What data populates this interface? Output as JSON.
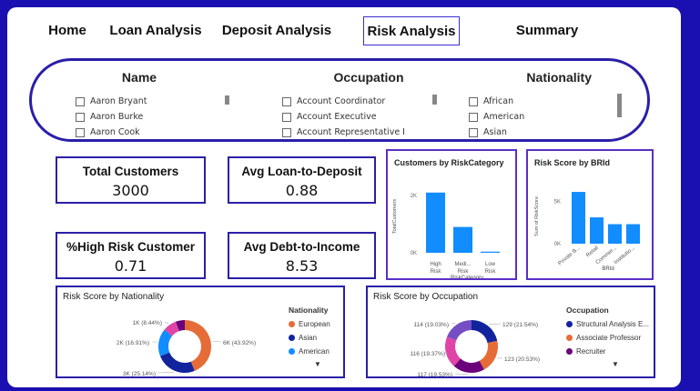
{
  "nav": {
    "home": "Home",
    "loan": "Loan Analysis",
    "deposit": "Deposit Analysis",
    "risk": "Risk Analysis",
    "summary": "Summary"
  },
  "slicers": {
    "name": {
      "title": "Name",
      "items": [
        "Aaron Bryant",
        "Aaron Burke",
        "Aaron Cook"
      ]
    },
    "occupation": {
      "title": "Occupation",
      "items": [
        "Account Coordinator",
        "Account Executive",
        "Account Representative I"
      ]
    },
    "nationality": {
      "title": "Nationality",
      "items": [
        "African",
        "American",
        "Asian"
      ]
    }
  },
  "kpis": {
    "total_customers": {
      "label": "Total Customers",
      "value": "3000"
    },
    "loan_to_deposit": {
      "label": "Avg Loan-to-Deposit",
      "value": "0.88"
    },
    "high_risk": {
      "label": "%High Risk Customer",
      "value": "0.71"
    },
    "debt_to_income": {
      "label": "Avg Debt-to-Income",
      "value": "8.53"
    }
  },
  "colors": {
    "accent": "#2a1fa8",
    "bar": "#118dff",
    "european": "#e66c37",
    "asian": "#12239e",
    "american": "#118dff",
    "pink": "#e044a7",
    "purple": "#6b007b",
    "violet": "#744ec2"
  },
  "chart_data": [
    {
      "type": "bar",
      "title": "Customers by RiskCategory",
      "categories": [
        "High Risk",
        "Medium Risk",
        "Low Risk"
      ],
      "tick_labels": [
        [
          "High",
          "Risk"
        ],
        [
          "Medi...",
          "Risk"
        ],
        [
          "Low",
          "Risk"
        ]
      ],
      "values": [
        2100,
        900,
        40
      ],
      "yticks": [
        "0K",
        "2K"
      ],
      "ylim": [
        0,
        2600
      ],
      "xlabel": "RiskCategory",
      "ylabel": "TotalCustomers"
    },
    {
      "type": "bar",
      "title": "Risk Score by BRId",
      "categories": [
        "Private B...",
        "Retail",
        "Commer...",
        "Institutio..."
      ],
      "values": [
        6100,
        3100,
        2300,
        2300
      ],
      "yticks": [
        "0K",
        "5K"
      ],
      "ylim": [
        0,
        7500
      ],
      "xlabel": "BRId",
      "ylabel": "Sum of RiskScore"
    },
    {
      "type": "pie",
      "title": "Risk Score by Nationality",
      "legend_title": "Nationality",
      "slices": [
        {
          "name": "European",
          "label": "6K (43.92%)",
          "pct": 43.92,
          "color": "#e66c37"
        },
        {
          "name": "Asian",
          "label": "3K (25.14%)",
          "pct": 25.14,
          "color": "#12239e"
        },
        {
          "name": "American",
          "label": "2K (16.91%)",
          "pct": 16.91,
          "color": "#118dff"
        },
        {
          "name": "",
          "label": "1K (8.44%)",
          "pct": 8.44,
          "color": "#e044a7"
        },
        {
          "name": "",
          "label": "",
          "pct": 5.59,
          "color": "#6b007b"
        }
      ],
      "legend": [
        "European",
        "Asian",
        "American"
      ]
    },
    {
      "type": "pie",
      "title": "Risk Score by Occupation",
      "legend_title": "Occupation",
      "slices": [
        {
          "name": "Structural Analysis E...",
          "label": "129 (21.54%)",
          "pct": 21.54,
          "color": "#12239e"
        },
        {
          "name": "Associate Professor",
          "label": "123 (20.53%)",
          "pct": 20.53,
          "color": "#e66c37"
        },
        {
          "name": "Recruiter",
          "label": "117 (19.53%)",
          "pct": 19.53,
          "color": "#6b007b"
        },
        {
          "name": "",
          "label": "116 (19.37%)",
          "pct": 19.37,
          "color": "#e044a7"
        },
        {
          "name": "",
          "label": "114 (19.03%)",
          "pct": 19.03,
          "color": "#744ec2"
        }
      ],
      "legend": [
        "Structural Analysis E...",
        "Associate Professor",
        "Recruiter"
      ]
    }
  ]
}
